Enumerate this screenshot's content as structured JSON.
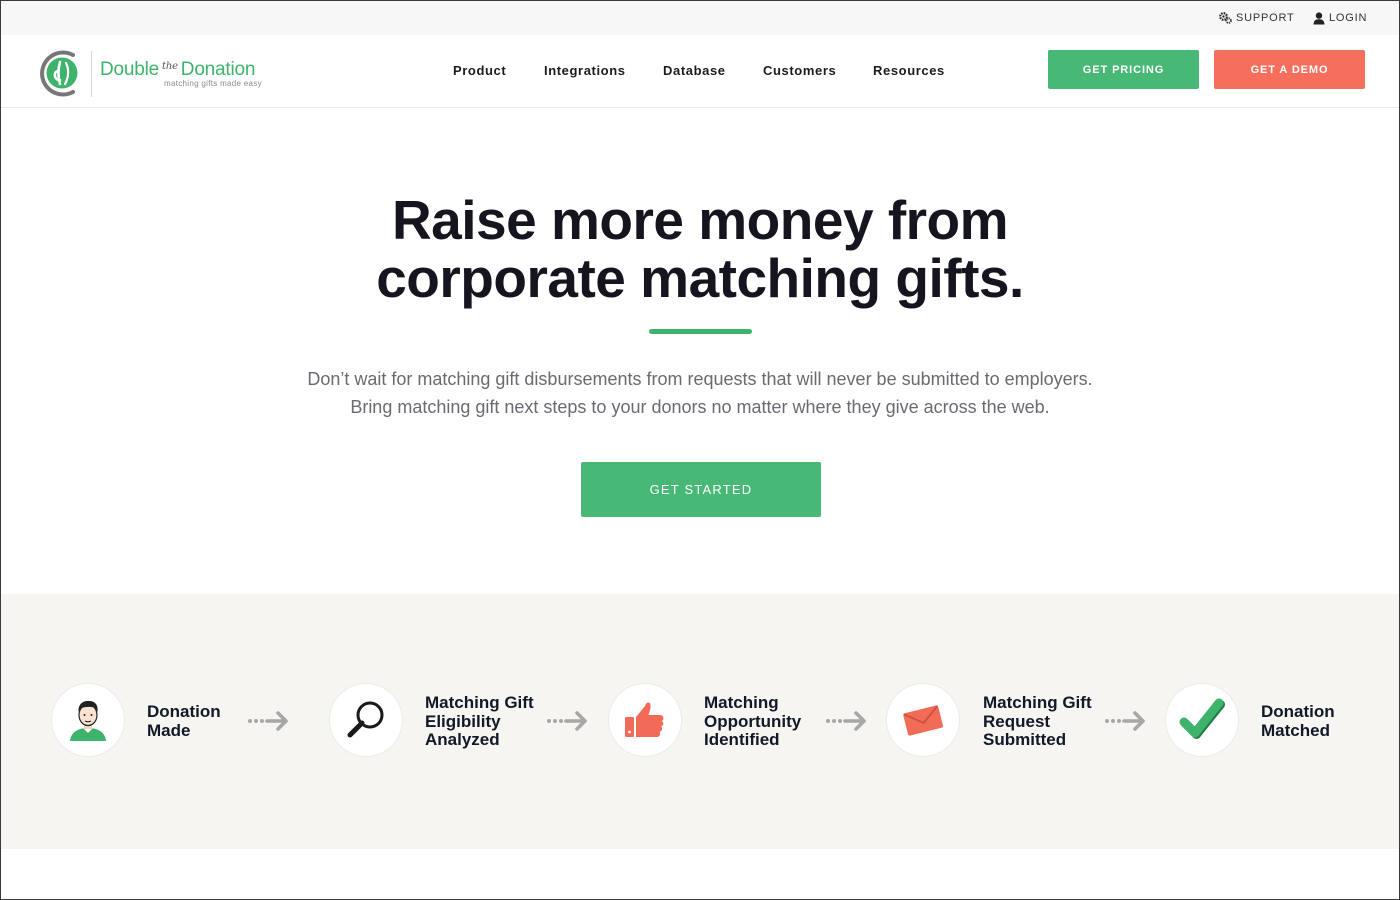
{
  "utility": {
    "support_label": "SUPPORT",
    "login_label": "LOGIN"
  },
  "header": {
    "logo": {
      "name_part1": "Double",
      "name_the": "the",
      "name_part2": "Donation",
      "tagline": "matching gifts made easy"
    },
    "nav": [
      "Product",
      "Integrations",
      "Database",
      "Customers",
      "Resources"
    ],
    "pricing_button": "GET PRICING",
    "demo_button": "GET A DEMO"
  },
  "hero": {
    "title_line1": "Raise more money from",
    "title_line2": "corporate matching gifts.",
    "subtitle_line1": "Don’t wait for matching gift disbursements from requests that will never be submitted to employers.",
    "subtitle_line2": "Bring matching gift next steps to your donors no matter where they give across the web.",
    "cta_label": "GET STARTED"
  },
  "steps": [
    {
      "icon": "person-icon",
      "lines": [
        "Donation",
        "Made"
      ]
    },
    {
      "icon": "magnifier-icon",
      "lines": [
        "Matching Gift",
        "Eligibility",
        "Analyzed"
      ]
    },
    {
      "icon": "thumbs-up-icon",
      "lines": [
        "Matching",
        "Opportunity",
        "Identified"
      ]
    },
    {
      "icon": "envelope-icon",
      "lines": [
        "Matching Gift",
        "Request",
        "Submitted"
      ]
    },
    {
      "icon": "checkmark-icon",
      "lines": [
        "Donation",
        "Matched"
      ]
    }
  ],
  "colors": {
    "brand_green": "#47b875",
    "accent_coral": "#f66f5c",
    "heading": "#15151f",
    "band_background": "#f6f5f2"
  }
}
